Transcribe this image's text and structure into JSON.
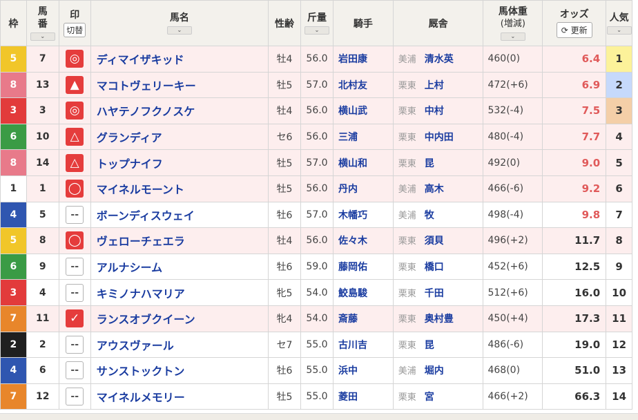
{
  "header": {
    "waku": "枠",
    "umaban_1": "馬",
    "umaban_2": "番",
    "mark": "印",
    "mark_toggle": "切替",
    "name": "馬名",
    "sexage": "性齢",
    "kinryo": "斤量",
    "jockey": "騎手",
    "stable": "厩舎",
    "bw_1": "馬体重",
    "bw_2": "(増減)",
    "odds": "オッズ",
    "refresh": "更新",
    "popularity": "人気",
    "chevron": "⌄"
  },
  "colors": {
    "waku_1": "#ffffff",
    "waku_2": "#1f1f1f",
    "waku_3": "#e23b3b",
    "waku_4": "#2f56b0",
    "waku_5": "#f1c629",
    "waku_6": "#3a9b45",
    "waku_7": "#e8862b",
    "waku_8": "#e87a8a",
    "pop_1": "#fcf29a",
    "pop_2": "#c6d9fb",
    "pop_3": "#f4cfa8"
  },
  "rows": [
    {
      "waku": "5",
      "umaban": "7",
      "mark": "◎",
      "name": "ディマイザキッド",
      "sexage": "牡4",
      "kinryo": "56.0",
      "jockey": "岩田康",
      "area": "美浦",
      "trainer": "清水英",
      "bw": "460(0)",
      "odds": "6.4",
      "pop": "1"
    },
    {
      "waku": "8",
      "umaban": "13",
      "mark": "▲",
      "name": "マコトヴェリーキー",
      "sexage": "牡5",
      "kinryo": "57.0",
      "jockey": "北村友",
      "area": "栗東",
      "trainer": "上村",
      "bw": "472(+6)",
      "odds": "6.9",
      "pop": "2"
    },
    {
      "waku": "3",
      "umaban": "3",
      "mark": "◎",
      "name": "ハヤテノフクノスケ",
      "sexage": "牡4",
      "kinryo": "56.0",
      "jockey": "横山武",
      "area": "栗東",
      "trainer": "中村",
      "bw": "532(-4)",
      "odds": "7.5",
      "pop": "3"
    },
    {
      "waku": "6",
      "umaban": "10",
      "mark": "△",
      "name": "グランディア",
      "sexage": "セ6",
      "kinryo": "56.0",
      "jockey": "三浦",
      "area": "栗東",
      "trainer": "中内田",
      "bw": "480(-4)",
      "odds": "7.7",
      "pop": "4"
    },
    {
      "waku": "8",
      "umaban": "14",
      "mark": "△",
      "name": "トップナイフ",
      "sexage": "牡5",
      "kinryo": "57.0",
      "jockey": "横山和",
      "area": "栗東",
      "trainer": "昆",
      "bw": "492(0)",
      "odds": "9.0",
      "pop": "5"
    },
    {
      "waku": "1",
      "umaban": "1",
      "mark": "◯",
      "name": "マイネルモーント",
      "sexage": "牡5",
      "kinryo": "56.0",
      "jockey": "丹内",
      "area": "美浦",
      "trainer": "高木",
      "bw": "466(-6)",
      "odds": "9.2",
      "pop": "6"
    },
    {
      "waku": "4",
      "umaban": "5",
      "mark": "--",
      "name": "ボーンディスウェイ",
      "sexage": "牡6",
      "kinryo": "57.0",
      "jockey": "木幡巧",
      "area": "美浦",
      "trainer": "牧",
      "bw": "498(-4)",
      "odds": "9.8",
      "pop": "7"
    },
    {
      "waku": "5",
      "umaban": "8",
      "mark": "◯",
      "name": "ヴェローチェエラ",
      "sexage": "牡4",
      "kinryo": "56.0",
      "jockey": "佐々木",
      "area": "栗東",
      "trainer": "須貝",
      "bw": "496(+2)",
      "odds": "11.7",
      "pop": "8"
    },
    {
      "waku": "6",
      "umaban": "9",
      "mark": "--",
      "name": "アルナシーム",
      "sexage": "牡6",
      "kinryo": "59.0",
      "jockey": "藤岡佑",
      "area": "栗東",
      "trainer": "橋口",
      "bw": "452(+6)",
      "odds": "12.5",
      "pop": "9"
    },
    {
      "waku": "3",
      "umaban": "4",
      "mark": "--",
      "name": "キミノナハマリア",
      "sexage": "牝5",
      "kinryo": "54.0",
      "jockey": "鮫島駿",
      "area": "栗東",
      "trainer": "千田",
      "bw": "512(+6)",
      "odds": "16.0",
      "pop": "10"
    },
    {
      "waku": "7",
      "umaban": "11",
      "mark": "✓",
      "name": "ランスオブクイーン",
      "sexage": "牝4",
      "kinryo": "54.0",
      "jockey": "斎藤",
      "area": "栗東",
      "trainer": "奥村豊",
      "bw": "450(+4)",
      "odds": "17.3",
      "pop": "11"
    },
    {
      "waku": "2",
      "umaban": "2",
      "mark": "--",
      "name": "アウスヴァール",
      "sexage": "セ7",
      "kinryo": "55.0",
      "jockey": "古川吉",
      "area": "栗東",
      "trainer": "昆",
      "bw": "486(-6)",
      "odds": "19.0",
      "pop": "12"
    },
    {
      "waku": "4",
      "umaban": "6",
      "mark": "--",
      "name": "サンストックトン",
      "sexage": "牡6",
      "kinryo": "55.0",
      "jockey": "浜中",
      "area": "美浦",
      "trainer": "堀内",
      "bw": "468(0)",
      "odds": "51.0",
      "pop": "13"
    },
    {
      "waku": "7",
      "umaban": "12",
      "mark": "--",
      "name": "マイネルメモリー",
      "sexage": "牡5",
      "kinryo": "55.0",
      "jockey": "菱田",
      "area": "栗東",
      "trainer": "宮",
      "bw": "466(+2)",
      "odds": "66.3",
      "pop": "14"
    }
  ]
}
